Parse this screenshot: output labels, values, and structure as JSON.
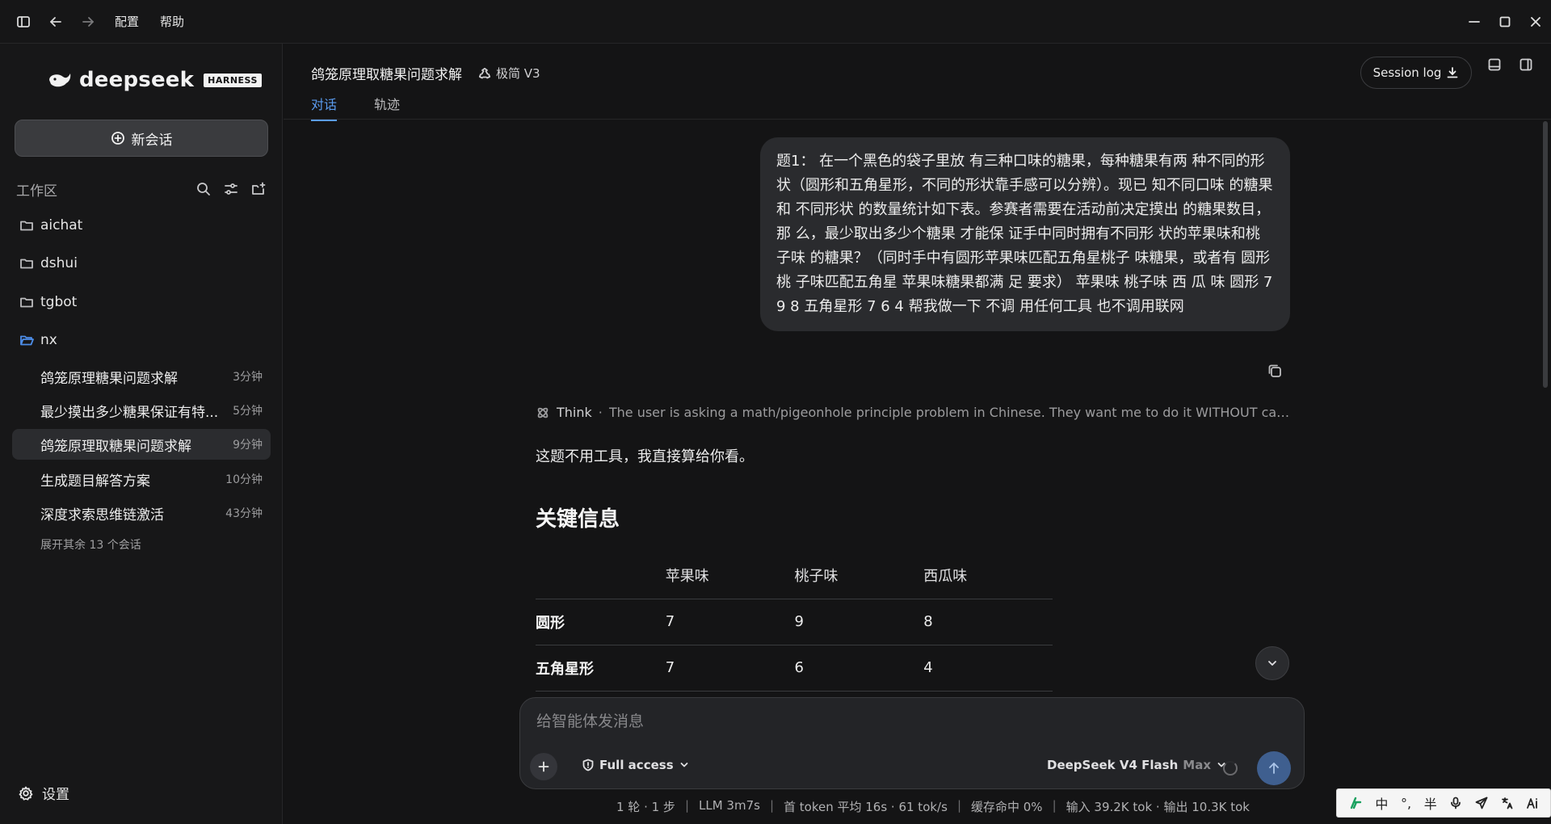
{
  "titlebar": {
    "menus": [
      "配置",
      "帮助"
    ]
  },
  "sidebar": {
    "brand_name": "deepseek",
    "brand_badge": "HARNESS",
    "new_chat_label": "新会话",
    "workspace_title": "工作区",
    "folders": [
      "aichat",
      "dshui",
      "tgbot",
      "nx"
    ],
    "sessions": [
      {
        "title": "鸽笼原理糖果问题求解",
        "time": "3分钟"
      },
      {
        "title": "最少摸出多少糖果保证有特...",
        "time": "5分钟"
      },
      {
        "title": "鸽笼原理取糖果问题求解",
        "time": "9分钟"
      },
      {
        "title": "生成题目解答方案",
        "time": "10分钟"
      },
      {
        "title": "深度求索思维链激活",
        "time": "43分钟"
      }
    ],
    "expand_more": "展开其余 13 个会话",
    "settings_label": "设置"
  },
  "header": {
    "title": "鸽笼原理取糖果问题求解",
    "mode": "极简 V3",
    "tabs": [
      "对话",
      "轨迹"
    ],
    "session_log": "Session log"
  },
  "chat": {
    "user_message": "题1： 在一个黑色的袋子里放 有三种口味的糖果，每种糖果有两 种不同的形状（圆形和五角星形，不同的形状靠手感可以分辨）。现已 知不同口味 的糖果和 不同形状 的数量统计如下表。参赛者需要在活动前决定摸出 的糖果数目，那 么，最少取出多少个糖果 才能保 证手中同时拥有不同形 状的苹果味和桃子味 的糖果？（同时手中有圆形苹果味匹配五角星桃子 味糖果，或者有 圆形桃 子味匹配五角星 苹果味糖果都满 足 要求） 苹果味 桃子味 西 瓜 味 圆形 7 9 8 五角星形 7 6 4 帮我做一下 不调 用任何工具 也不调用联网",
    "think_label": "Think",
    "think_dot": "·",
    "think_text": "The user is asking a math/pigeonhole principle problem in Chinese. They want me to do it WITHOUT calling...",
    "answer_intro": "这题不用工具，我直接算给你看。",
    "answer_heading": "关键信息",
    "table": {
      "headers": [
        "",
        "苹果味",
        "桃子味",
        "西瓜味"
      ],
      "rows": [
        [
          "圆形",
          "7",
          "9",
          "8"
        ],
        [
          "五角星形",
          "7",
          "6",
          "4"
        ]
      ]
    }
  },
  "composer": {
    "placeholder": "给智能体发消息",
    "access_label": "Full access",
    "model_name": "DeepSeek V4 Flash",
    "model_tier": "Max"
  },
  "status": {
    "turns": "1 轮 · 1 步",
    "llm": "LLM 3m7s",
    "token": "首 token 平均 16s · 61 tok/s",
    "cache": "缓存命中 0%",
    "io": "输入 39.2K tok · 输出 10.3K tok",
    "separator": "|"
  },
  "ime": {
    "items": [
      "中",
      "°,",
      "半"
    ]
  },
  "colors": {
    "accent": "#5b9cf0",
    "background": "#141415",
    "sidebar": "#171718",
    "bubble": "#2a2b2e"
  }
}
